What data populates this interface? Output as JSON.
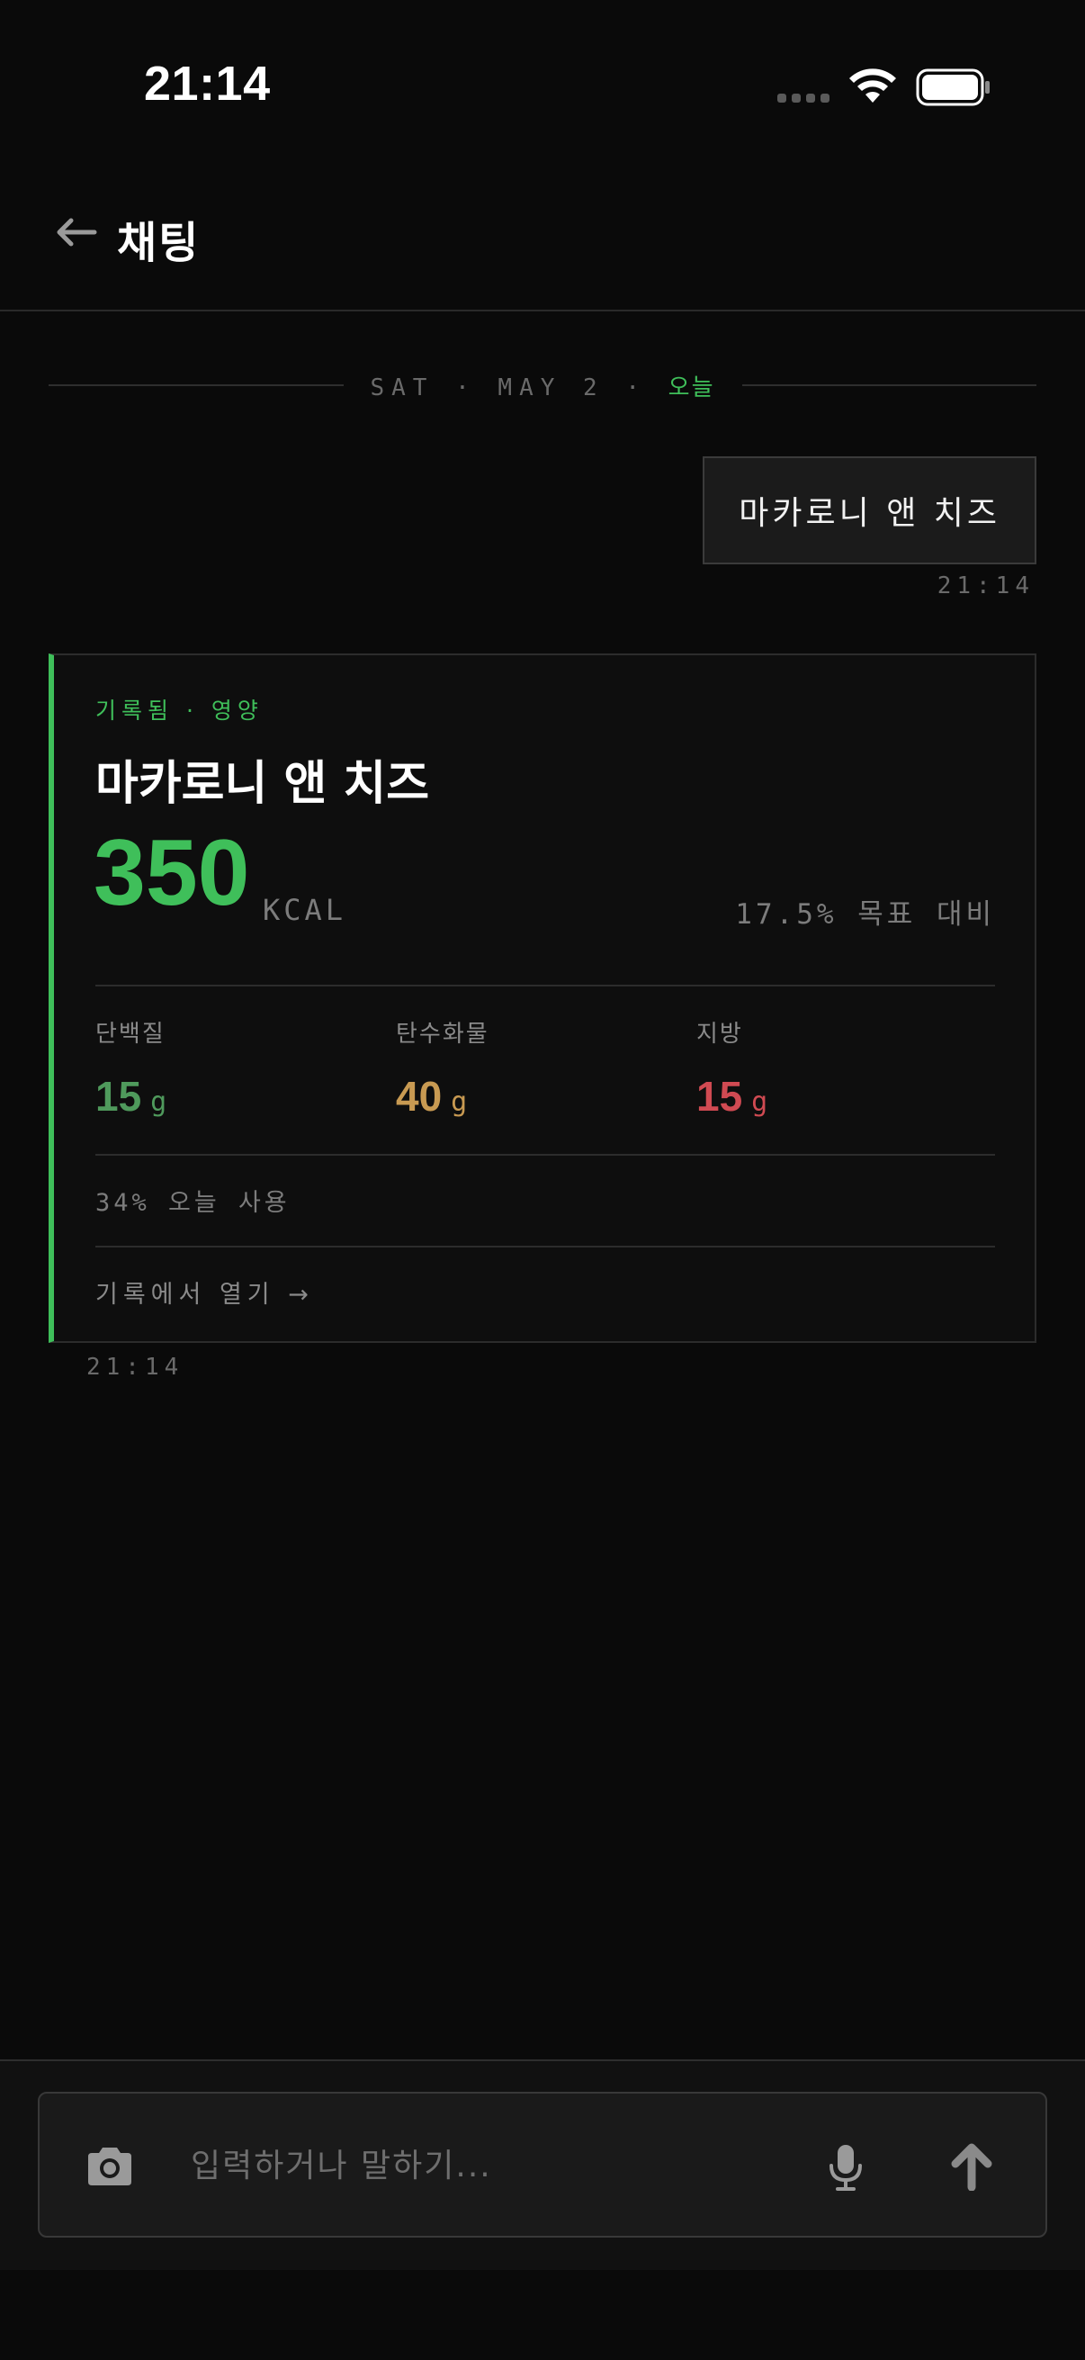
{
  "status_bar": {
    "time": "21:14",
    "icons": [
      "signal-icon",
      "wifi-icon",
      "battery-icon"
    ]
  },
  "header": {
    "back_icon": "arrow-left-icon",
    "title": "채팅"
  },
  "date_divider": {
    "date": "SAT · MAY 2 ·",
    "today": "오늘"
  },
  "user_message": {
    "text": "마카로니 앤 치즈",
    "time": "21:14"
  },
  "log_card": {
    "tag": "기록됨 · 영양",
    "title": "마카로니 앤 치즈",
    "kcal": "350",
    "kcal_unit": "KCAL",
    "goal": "17.5% 목표 대비",
    "macros": [
      {
        "label": "단백질",
        "value": "15",
        "unit": "g",
        "color": "#4f9a5c"
      },
      {
        "label": "탄수화물",
        "value": "40",
        "unit": "g",
        "color": "#c89a52"
      },
      {
        "label": "지방",
        "value": "15",
        "unit": "g",
        "color": "#d04a52"
      }
    ],
    "usage": "34% 오늘 사용",
    "open_link": "기록에서 열기 →",
    "time": "21:14",
    "accent_color": "#3fbf5a"
  },
  "composer": {
    "placeholder": "입력하거나 말하기...",
    "camera_icon": "camera-icon",
    "mic_icon": "microphone-icon",
    "send_icon": "send-arrow-up-icon"
  },
  "colors": {
    "background": "#0a0a0a",
    "accent": "#3fbf5a",
    "muted_text": "#6a6a6a"
  }
}
